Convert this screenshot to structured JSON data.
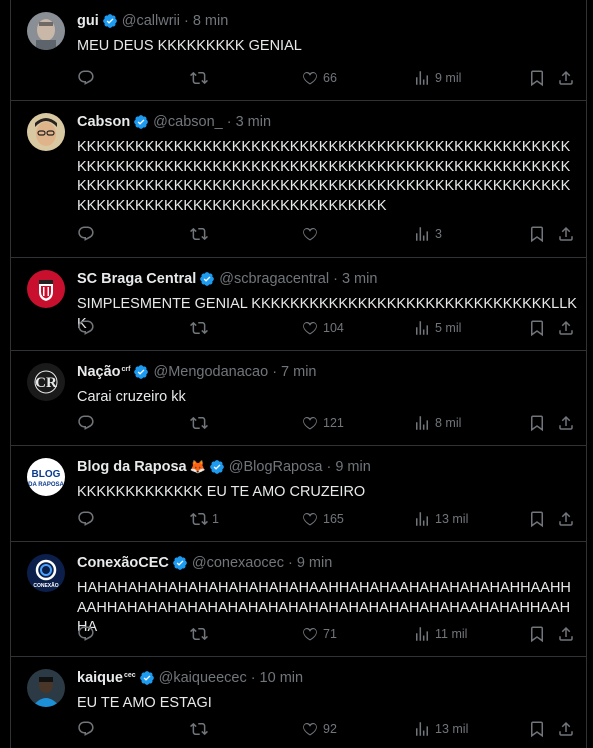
{
  "tweets": [
    {
      "name": "gui",
      "name_sup": "",
      "emoji": "",
      "handle": "@callwrii",
      "time": "8 min",
      "text": "MEU DEUS KKKKKKKKK GENIAL",
      "reply_count": "",
      "retweet_count": "",
      "like_count": "66",
      "view_count": "9 mil",
      "avatar": "photo-gray-man"
    },
    {
      "name": "Cabson",
      "name_sup": "",
      "emoji": "",
      "handle": "@cabson_",
      "time": "3 min",
      "text": "KKKKKKKKKKKKKKKKKKKKKKKKKKKKKKKKKKKKKKKKKKKKKKKKKKKKKKKKKKKKKKKKKKKKKKKKKKKKKKKKKKKKKKKKKKKKKKKKKKKKKKKKKKKKKKKKKKKKKKKKKKKKKKKKKKKKKKKKKKKKKKKKKKKKKKKKKKKKKKKKKKKKKKKKKKKKKKKKKKKKKKKKK",
      "reply_count": "",
      "retweet_count": "",
      "like_count": "",
      "view_count": "3",
      "avatar": "photo-man-glasses"
    },
    {
      "name": "SC Braga Central",
      "name_sup": "",
      "emoji": "",
      "handle": "@scbragacentral",
      "time": "3 min",
      "text": "SIMPLESMENTE GENIAL KKKKKKKKKKKKKKKKKKKKKKKKKKKKKKKLLKK",
      "reply_count": "",
      "retweet_count": "",
      "like_count": "104",
      "view_count": "5 mil",
      "avatar": "braga-crest"
    },
    {
      "name": "Nação",
      "name_sup": "crf",
      "emoji": "",
      "handle": "@Mengodanacao",
      "time": "7 min",
      "text": "Carai cruzeiro kk",
      "reply_count": "",
      "retweet_count": "",
      "like_count": "121",
      "view_count": "8 mil",
      "avatar": "crf-monogram"
    },
    {
      "name": "Blog da Raposa",
      "name_sup": "",
      "emoji": "🦊",
      "handle": "@BlogRaposa",
      "time": "9 min",
      "text": "KKKKKKKKKKKKK EU TE AMO CRUZEIRO",
      "reply_count": "",
      "retweet_count": "1",
      "like_count": "165",
      "view_count": "13 mil",
      "avatar": "blog-logo"
    },
    {
      "name": "ConexãoCEC",
      "name_sup": "",
      "emoji": "",
      "handle": "@conexaocec",
      "time": "9 min",
      "text": "HAHAHAHAHAHAHAHAHAHAHAHAAHHAHAHAAHAHAHAHAHAHHAAHHAAHHAHAHAHAHAHAHAHAHAHAHAHAHAHAHAHAHAHAAHAHAHHAAHHA",
      "reply_count": "",
      "retweet_count": "",
      "like_count": "71",
      "view_count": "11 mil",
      "avatar": "conexao-logo"
    },
    {
      "name": "kaique",
      "name_sup": "cec",
      "emoji": "",
      "handle": "@kaiqueecec",
      "time": "10 min",
      "text": "EU TE AMO ESTAGI",
      "reply_count": "",
      "retweet_count": "",
      "like_count": "92",
      "view_count": "13 mil",
      "avatar": "photo-blue-shirt"
    }
  ],
  "colors": {
    "accent": "#1d9bf0",
    "muted": "#71767b",
    "text": "#e7e9ea",
    "border": "#2f3336",
    "background": "#000000"
  },
  "icons": {
    "reply": "reply-icon",
    "retweet": "retweet-icon",
    "like": "like-icon",
    "views": "views-icon",
    "bookmark": "bookmark-icon",
    "share": "share-icon",
    "verified": "verified-icon"
  }
}
